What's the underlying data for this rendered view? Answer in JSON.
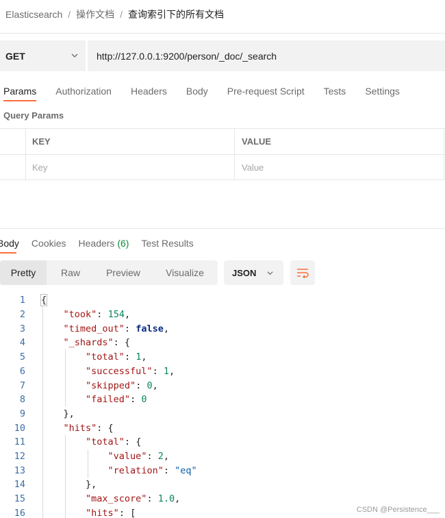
{
  "breadcrumb": {
    "items": [
      "Elasticsearch",
      "操作文档",
      "查询索引下的所有文档"
    ],
    "separator": "/"
  },
  "request": {
    "method": "GET",
    "url": "http://127.0.0.1:9200/person/_doc/_search"
  },
  "request_tabs": [
    "Params",
    "Authorization",
    "Headers",
    "Body",
    "Pre-request Script",
    "Tests",
    "Settings"
  ],
  "active_request_tab": "Params",
  "query_params": {
    "title": "Query Params",
    "columns": [
      "KEY",
      "VALUE"
    ],
    "key_placeholder": "Key",
    "value_placeholder": "Value"
  },
  "response_tabs": {
    "body": "Body",
    "cookies": "Cookies",
    "headers": "Headers",
    "headers_count": "(6)",
    "test_results": "Test Results"
  },
  "view_modes": [
    "Pretty",
    "Raw",
    "Preview",
    "Visualize"
  ],
  "active_view_mode": "Pretty",
  "format": "JSON",
  "icons": {
    "method_dropdown": "chevron-down-icon",
    "format_dropdown": "chevron-down-icon",
    "wrap": "wrap-lines-icon"
  },
  "colors": {
    "accent": "#ff6c37",
    "key": "#a31515",
    "number": "#098658",
    "boolean": "#0b2c86",
    "string": "#0a5fa8",
    "line_number": "#3a6ea5",
    "headers_count": "#0f8a3a"
  },
  "code_lines": [
    "{",
    "    \"took\": 154,",
    "    \"timed_out\": false,",
    "    \"_shards\": {",
    "        \"total\": 1,",
    "        \"successful\": 1,",
    "        \"skipped\": 0,",
    "        \"failed\": 0",
    "    },",
    "    \"hits\": {",
    "        \"total\": {",
    "            \"value\": 2,",
    "            \"relation\": \"eq\"",
    "        },",
    "        \"max_score\": 1.0,",
    "        \"hits\": ["
  ],
  "watermark": "CSDN @Persistence___"
}
